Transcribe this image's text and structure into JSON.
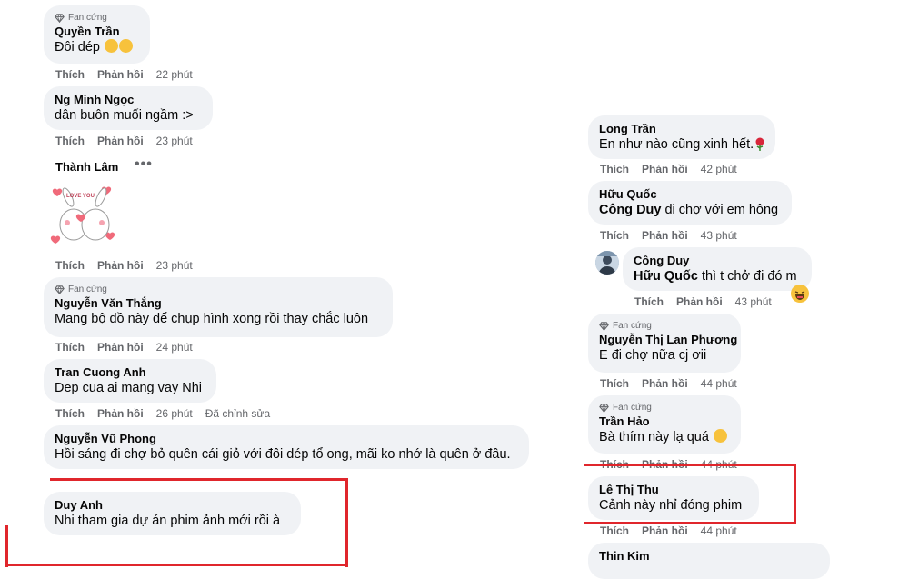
{
  "badge_label": "Fan cứng",
  "labels": {
    "like": "Thích",
    "reply": "Phản hồi",
    "edited": "Đã chỉnh sửa"
  },
  "left": {
    "c1": {
      "name": "Quyền Trần",
      "text": "Đôi dép",
      "time": "22 phút"
    },
    "c2": {
      "name": "Ng Minh Ngọc",
      "text": "dân buôn muối ngầm :>",
      "time": "23 phút"
    },
    "c3": {
      "name": "Thành Lâm",
      "sticker_text": "LOVE YOU",
      "time": "23 phút"
    },
    "c4": {
      "name": "Nguyễn Văn Thắng",
      "text": "Mang bộ đồ này để chụp hình xong rồi thay chắc luôn",
      "time": "24 phút"
    },
    "c5": {
      "name": "Tran Cuong Anh",
      "text": "Dep cua ai mang vay Nhi",
      "time": "26 phút"
    },
    "c6": {
      "name": "Nguyễn Vũ Phong",
      "text": "Hồi sáng đi chợ bỏ quên cái giỏ với đôi dép tổ ong, mãi ko nhớ là quên ở đâu."
    },
    "c7": {
      "name": "Duy Anh",
      "text": "Nhi tham gia dự án phim ảnh mới rồi à"
    }
  },
  "right": {
    "c1": {
      "name": "Long Trần",
      "text": "En như nào cũng xinh hết.",
      "time": "42 phút"
    },
    "c2": {
      "name": "Hữu Quốc",
      "mention": "Công Duy",
      "text": " đi chợ với em hông",
      "time": "43 phút"
    },
    "c3": {
      "name": "Công Duy",
      "mention": "Hữu Quốc",
      "text": " thì t chở đi đó m",
      "time": "43 phút"
    },
    "c4": {
      "name": "Nguyễn Thị Lan Phương",
      "text": "E đi chợ nữa cj ơii",
      "time": "44 phút"
    },
    "c5": {
      "name": "Trần Hảo",
      "text": "Bà thím này lạ quá",
      "time": "44 phút"
    },
    "c6": {
      "name": "Lê Thị Thu",
      "text": "Cảnh này nhỉ đóng phim",
      "time": "44 phút"
    },
    "c7": {
      "name": "Thin Kim"
    }
  },
  "colors": {
    "highlight_box": "#e0262c",
    "bubble": "#f0f2f5",
    "meta": "#65676b"
  },
  "icons": [
    "diamond-icon",
    "laughing-emoji-icon",
    "rose-emoji-icon",
    "more-options-icon"
  ]
}
